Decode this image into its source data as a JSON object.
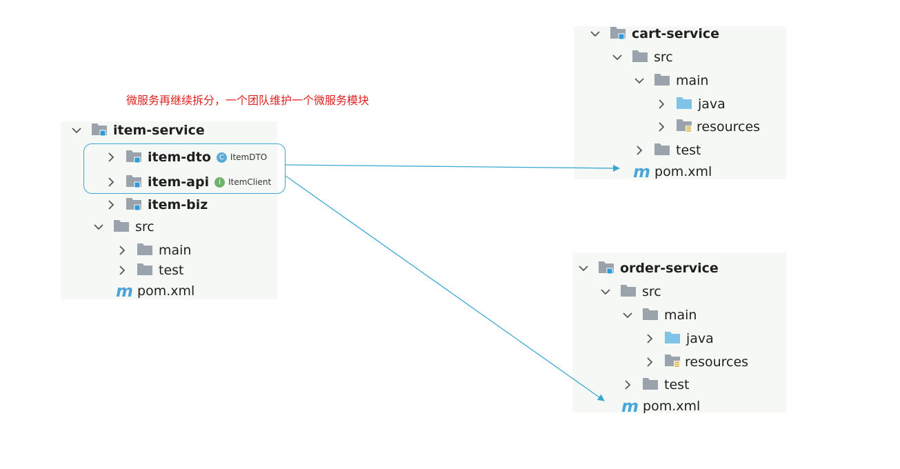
{
  "caption": "微服务再继续拆分，一个团队维护一个微服务模块",
  "item_tree": {
    "root": "item-service",
    "modules": [
      {
        "label": "item-dto",
        "badge_type": "C",
        "badge_label": "ItemDTO"
      },
      {
        "label": "item-api",
        "badge_type": "I",
        "badge_label": "ItemClient"
      },
      {
        "label": "item-biz"
      }
    ],
    "src": "src",
    "main": "main",
    "test": "test",
    "pom": "pom.xml"
  },
  "cart_tree": {
    "root": "cart-service",
    "src": "src",
    "main": "main",
    "java": "java",
    "resources": "resources",
    "test": "test",
    "pom": "pom.xml"
  },
  "order_tree": {
    "root": "order-service",
    "src": "src",
    "main": "main",
    "java": "java",
    "resources": "resources",
    "test": "test",
    "pom": "pom.xml"
  },
  "icons": {
    "module": "module-folder-icon",
    "folder": "folder-icon",
    "source_folder": "source-folder-icon",
    "resources_folder": "resources-folder-icon",
    "maven": "maven-pom-icon",
    "chevron_down": "chevron-down-icon",
    "chevron_right": "chevron-right-icon"
  },
  "colors": {
    "caption": "#e02020",
    "arrow": "#39a7d4",
    "folder_gray": "#9aa3ab",
    "folder_blue": "#7fc3e6",
    "module_marker": "#2e9ad6"
  }
}
